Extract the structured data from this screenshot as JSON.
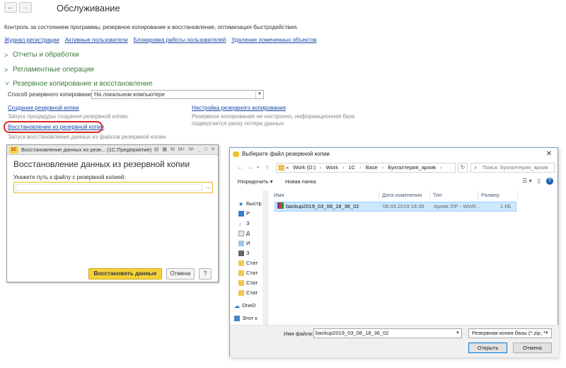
{
  "nav": {
    "back": "←",
    "forward": "→"
  },
  "page": {
    "title": "Обслуживание",
    "subtitle": "Контроль за состоянием программы, резервное копирование и восстановление, оптимизация быстродействия.",
    "links": [
      "Журнал регистрации",
      "Активные пользователи",
      "Блокировка работы пользователей",
      "Удаление помеченных объектов"
    ]
  },
  "groups": [
    {
      "label": "Отчеты и обработки",
      "expanded": false
    },
    {
      "label": "Регламентные операции",
      "expanded": false
    },
    {
      "label": "Резервное копирование и восстановление",
      "expanded": true
    }
  ],
  "backup": {
    "method_label": "Способ резервного копирования:",
    "method_value": "На локальном компьютере",
    "create_link": "Создание резервной копии",
    "create_hint": "Запуск процедуры создания резервной копии.",
    "restore_link": "Восстановление из резервной копии",
    "restore_hint": "Запуск восстановления данных из файлов резервной копии.",
    "settings_link": "Настройка резервного копирования",
    "settings_hint_1": "Резервное копирование не настроено, информационная база",
    "settings_hint_2": "подвергается риску потери данных."
  },
  "restore_dialog": {
    "window_title": "Восстановление данных из резе... (1С:Предприятие)",
    "logo": "1С",
    "heading": "Восстановление данных из резервной копии",
    "path_label": "Укажите путь к файлу с резервной копией:",
    "path_value": "",
    "path_button": "...",
    "toolbar_icons": [
      "M",
      "M+",
      "M-"
    ],
    "restore_button": "Восстановить данные",
    "cancel_button": "Отмена",
    "help_button": "?",
    "accent": "#f6d23a"
  },
  "file_dialog": {
    "title": "Выберите файл резервной копии",
    "close": "✕",
    "path_prefix": "«",
    "path": [
      "Work (D:)",
      "Work",
      "1C",
      "Base",
      "Бухгалтерия_архив"
    ],
    "search_placeholder": "Поиск: Бухгалтерия_архив",
    "organize": "Упорядочить ▾",
    "new_folder": "Новая папка",
    "nav_items": [
      "Быстр",
      "Р",
      "З",
      "Д",
      "И",
      "З",
      "Стат",
      "Стат",
      "Стат",
      "Стат",
      "OneD",
      "Этот к"
    ],
    "columns": [
      "Имя",
      "Дата изменения",
      "Тип",
      "Размер"
    ],
    "files": [
      {
        "name": "backup2019_03_08_18_36_02",
        "date": "08.03.2019 18:36",
        "type": "Архив ZIP - WinR...",
        "size": "1 КБ"
      }
    ],
    "filename_label": "Имя файла:",
    "filename_value": "backup2019_03_08_18_36_02",
    "filter": "Резервная копия базы (*.zip, *",
    "open_button": "Открыть",
    "cancel_button": "Отмена"
  }
}
